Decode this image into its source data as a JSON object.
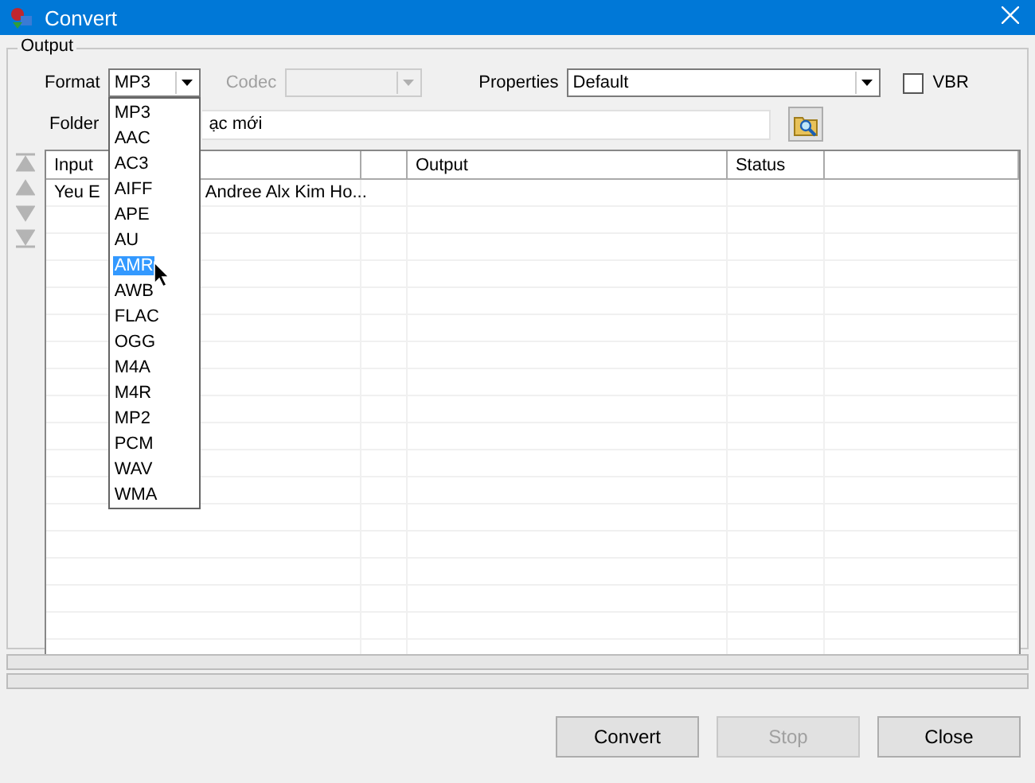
{
  "window": {
    "title": "Convert"
  },
  "group": {
    "title": "Output"
  },
  "format": {
    "label": "Format",
    "value": "MP3",
    "open": true,
    "options": [
      {
        "label": "MP3",
        "highlighted": false
      },
      {
        "label": "AAC",
        "highlighted": false
      },
      {
        "label": "AC3",
        "highlighted": false
      },
      {
        "label": "AIFF",
        "highlighted": false
      },
      {
        "label": "APE",
        "highlighted": false
      },
      {
        "label": "AU",
        "highlighted": false
      },
      {
        "label": "AMR",
        "highlighted": true
      },
      {
        "label": "AWB",
        "highlighted": false
      },
      {
        "label": "FLAC",
        "highlighted": false
      },
      {
        "label": "OGG",
        "highlighted": false
      },
      {
        "label": "M4A",
        "highlighted": false
      },
      {
        "label": "M4R",
        "highlighted": false
      },
      {
        "label": "MP2",
        "highlighted": false
      },
      {
        "label": "PCM",
        "highlighted": false
      },
      {
        "label": "WAV",
        "highlighted": false
      },
      {
        "label": "WMA",
        "highlighted": false
      }
    ]
  },
  "codec": {
    "label": "Codec",
    "disabled": true
  },
  "properties": {
    "label": "Properties",
    "value": "Default"
  },
  "vbr": {
    "label": "VBR",
    "checked": false
  },
  "folder": {
    "label": "Folder",
    "value": "ạc mới"
  },
  "move_buttons": [
    {
      "kind": "top"
    },
    {
      "kind": "up"
    },
    {
      "kind": "down"
    },
    {
      "kind": "bottom"
    }
  ],
  "table": {
    "columns": [
      {
        "kind": "input",
        "label": "Input"
      },
      {
        "kind": "blank"
      },
      {
        "kind": "output",
        "label": "Output"
      },
      {
        "kind": "status",
        "label": "Status"
      },
      {
        "kind": "blank"
      }
    ],
    "rows": [
      {
        "input": [
          "Yeu E",
          "Andree Alx Kim Ho..."
        ]
      }
    ]
  },
  "progress": [
    {
      "level": 0
    },
    {
      "level": 0
    }
  ],
  "buttons": [
    {
      "label": "Convert",
      "disabled": false
    },
    {
      "label": "Stop",
      "disabled": true
    },
    {
      "label": "Close",
      "disabled": false
    }
  ]
}
